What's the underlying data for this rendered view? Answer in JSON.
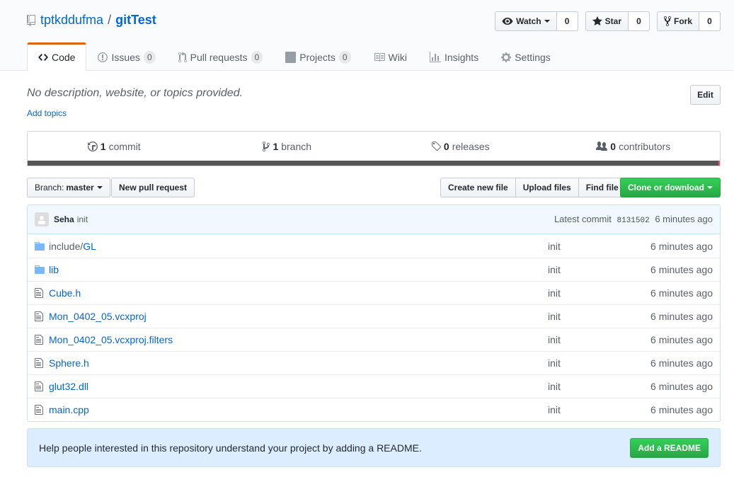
{
  "repo": {
    "owner": "tptkddufma",
    "separator": "/",
    "name": "gitTest"
  },
  "actions": {
    "watch": {
      "label": "Watch",
      "count": "0"
    },
    "star": {
      "label": "Star",
      "count": "0"
    },
    "fork": {
      "label": "Fork",
      "count": "0"
    }
  },
  "tabs": [
    {
      "label": "Code",
      "icon": "code-icon",
      "selected": true
    },
    {
      "label": "Issues",
      "icon": "issue-icon",
      "count": "0"
    },
    {
      "label": "Pull requests",
      "icon": "pull-request-icon",
      "count": "0"
    },
    {
      "label": "Projects",
      "icon": "project-icon",
      "count": "0"
    },
    {
      "label": "Wiki",
      "icon": "book-icon"
    },
    {
      "label": "Insights",
      "icon": "graph-icon"
    },
    {
      "label": "Settings",
      "icon": "gear-icon"
    }
  ],
  "description": "No description, website, or topics provided.",
  "add_topics": "Add topics",
  "edit_label": "Edit",
  "summary": {
    "commits": {
      "num": "1",
      "label": "commit"
    },
    "branches": {
      "num": "1",
      "label": "branch"
    },
    "releases": {
      "num": "0",
      "label": "releases"
    },
    "contributors": {
      "num": "0",
      "label": "contributors"
    }
  },
  "filebar": {
    "branch_prefix": "Branch:",
    "branch_name": "master",
    "new_pr": "New pull request",
    "create_file": "Create new file",
    "upload_files": "Upload files",
    "find_file": "Find file",
    "clone": "Clone or download"
  },
  "latest_commit": {
    "author": "Seha",
    "message": "init",
    "prefix": "Latest commit",
    "sha": "8131502",
    "age": "6 minutes ago"
  },
  "files": [
    {
      "type": "dir",
      "prefix": "include/",
      "name": "GL",
      "message": "init",
      "age": "6 minutes ago"
    },
    {
      "type": "dir",
      "prefix": "",
      "name": "lib",
      "message": "init",
      "age": "6 minutes ago"
    },
    {
      "type": "file",
      "prefix": "",
      "name": "Cube.h",
      "message": "init",
      "age": "6 minutes ago"
    },
    {
      "type": "file",
      "prefix": "",
      "name": "Mon_0402_05.vcxproj",
      "message": "init",
      "age": "6 minutes ago"
    },
    {
      "type": "file",
      "prefix": "",
      "name": "Mon_0402_05.vcxproj.filters",
      "message": "init",
      "age": "6 minutes ago"
    },
    {
      "type": "file",
      "prefix": "",
      "name": "Sphere.h",
      "message": "init",
      "age": "6 minutes ago"
    },
    {
      "type": "file",
      "prefix": "",
      "name": "glut32.dll",
      "message": "init",
      "age": "6 minutes ago"
    },
    {
      "type": "file",
      "prefix": "",
      "name": "main.cpp",
      "message": "init",
      "age": "6 minutes ago"
    }
  ],
  "readme": {
    "text": "Help people interested in this repository understand your project by adding a README.",
    "button": "Add a README"
  },
  "colors": {
    "accent": "#0366d6",
    "green": "#28a745",
    "tab_border": "#e36209",
    "lang_bar": "#555555"
  }
}
